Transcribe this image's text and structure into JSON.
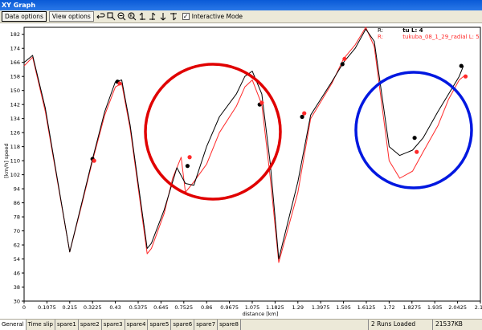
{
  "window": {
    "title": "XY Graph"
  },
  "toolbar": {
    "data_options": "Data options",
    "view_options": "View options",
    "interactive_mode_label": "Interactive Mode",
    "interactive_mode_checked": "✓",
    "icons": [
      "undo-icon",
      "zoom-box-icon",
      "zoom-out-icon",
      "zoom-fit-icon",
      "arrow-up-left-icon",
      "arrow-up-right-icon",
      "arrow-down-icon",
      "arrow-down-right-icon"
    ]
  },
  "legend": {
    "black_prefix": "R:",
    "black_label": "tu  L: 4",
    "red_prefix": "R:",
    "red_label": "tukuba_08_1_29_radial  L: 5"
  },
  "colors": {
    "black_trace": "#000000",
    "red_trace": "#ff2a2a",
    "red_circle": "#e00000",
    "blue_circle": "#0018e0"
  },
  "chart_data": {
    "type": "line",
    "xlabel": "distance [km]",
    "ylabel": "[km/h] speed",
    "xlim": [
      0,
      2.15
    ],
    "ylim": [
      30,
      186
    ],
    "x_ticks": [
      "0",
      "0.1075",
      "0.215",
      "0.3225",
      "0.43",
      "0.5375",
      "0.645",
      "0.7525",
      "0.86",
      "0.9675",
      "1.075",
      "1.1825",
      "1.29",
      "1.3975",
      "1.505",
      "1.6125",
      "1.72",
      "1.8275",
      "1.935",
      "2.0425",
      "2.15"
    ],
    "y_ticks": [
      "30",
      "38",
      "46",
      "54",
      "62",
      "70",
      "78",
      "86",
      "94",
      "102",
      "110",
      "118",
      "126",
      "134",
      "142",
      "150",
      "158",
      "166",
      "174",
      "182"
    ],
    "series": [
      {
        "name": "tu",
        "color": "#000000",
        "x": [
          0,
          0.04,
          0.1,
          0.215,
          0.27,
          0.3225,
          0.38,
          0.43,
          0.46,
          0.5,
          0.58,
          0.6,
          0.66,
          0.72,
          0.76,
          0.8,
          0.86,
          0.92,
          1.0,
          1.04,
          1.075,
          1.12,
          1.16,
          1.2,
          1.29,
          1.35,
          1.45,
          1.505,
          1.56,
          1.61,
          1.65,
          1.72,
          1.77,
          1.83,
          1.88,
          1.95,
          2.0,
          2.05,
          2.07
        ],
        "y": [
          166,
          170,
          140,
          58,
          85,
          111,
          138,
          155,
          156,
          130,
          60,
          63,
          82,
          106,
          97,
          96,
          118,
          135,
          148,
          158,
          161,
          148,
          108,
          54,
          98,
          136,
          155,
          166,
          174,
          185,
          178,
          118,
          113,
          116,
          123,
          138,
          148,
          158,
          164
        ]
      },
      {
        "name": "tukuba_08_1_29_radial",
        "color": "#ff2a2a",
        "x": [
          0,
          0.04,
          0.1,
          0.215,
          0.27,
          0.3225,
          0.38,
          0.43,
          0.46,
          0.5,
          0.58,
          0.6,
          0.66,
          0.7,
          0.74,
          0.76,
          0.8,
          0.86,
          0.92,
          1.0,
          1.04,
          1.075,
          1.12,
          1.16,
          1.2,
          1.29,
          1.35,
          1.45,
          1.505,
          1.56,
          1.61,
          1.65,
          1.72,
          1.77,
          1.83,
          1.88,
          1.95,
          2.0,
          2.05,
          2.07
        ],
        "y": [
          164,
          169,
          138,
          58,
          84,
          110,
          136,
          152,
          154,
          128,
          57,
          60,
          80,
          100,
          112,
          92,
          98,
          108,
          126,
          141,
          152,
          156,
          142,
          100,
          52,
          92,
          134,
          154,
          168,
          176,
          186,
          175,
          110,
          100,
          104,
          115,
          130,
          145,
          156,
          158
        ]
      }
    ],
    "markers": [
      {
        "series": 0,
        "x": 0.3225,
        "y": 111
      },
      {
        "series": 1,
        "x": 0.33,
        "y": 110
      },
      {
        "series": 0,
        "x": 0.44,
        "y": 155
      },
      {
        "series": 1,
        "x": 0.45,
        "y": 154
      },
      {
        "series": 0,
        "x": 0.77,
        "y": 107
      },
      {
        "series": 1,
        "x": 0.78,
        "y": 112
      },
      {
        "series": 0,
        "x": 1.11,
        "y": 142
      },
      {
        "series": 1,
        "x": 1.12,
        "y": 143
      },
      {
        "series": 0,
        "x": 1.31,
        "y": 135
      },
      {
        "series": 1,
        "x": 1.32,
        "y": 137
      },
      {
        "series": 0,
        "x": 1.5,
        "y": 165
      },
      {
        "series": 1,
        "x": 1.51,
        "y": 168
      },
      {
        "series": 0,
        "x": 1.84,
        "y": 123
      },
      {
        "series": 1,
        "x": 1.85,
        "y": 115
      },
      {
        "series": 0,
        "x": 2.06,
        "y": 164
      },
      {
        "series": 1,
        "x": 2.08,
        "y": 158
      }
    ]
  },
  "tabs": [
    "General",
    "Time slip",
    "spare1",
    "spare2",
    "spare3",
    "spare4",
    "spare5",
    "spare6",
    "spare7",
    "spare8"
  ],
  "status": {
    "runs": "2 Runs Loaded",
    "memory": "21537KB"
  }
}
